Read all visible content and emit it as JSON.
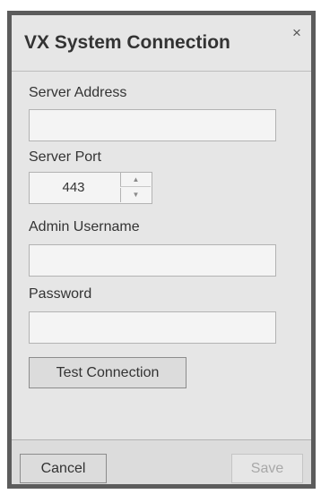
{
  "dialog": {
    "title": "VX System Connection",
    "close_symbol": "×"
  },
  "form": {
    "server_address": {
      "label": "Server Address",
      "value": "",
      "placeholder": ""
    },
    "server_port": {
      "label": "Server Port",
      "value": "443",
      "up_symbol": "▲",
      "down_symbol": "▼"
    },
    "admin_username": {
      "label": "Admin Username",
      "value": "",
      "placeholder": ""
    },
    "password": {
      "label": "Password",
      "value": "",
      "placeholder": ""
    },
    "test_button_label": "Test Connection"
  },
  "footer": {
    "cancel_label": "Cancel",
    "save_label": "Save",
    "save_enabled": false
  },
  "icons": {
    "close": "close-icon",
    "stepper_up": "chevron-up-icon",
    "stepper_down": "chevron-down-icon"
  },
  "colors": {
    "dialog_border": "#5c5c5c",
    "dialog_background": "#e6e6e6",
    "input_background": "#f4f4f4",
    "disabled_text": "#a8a8a8"
  }
}
